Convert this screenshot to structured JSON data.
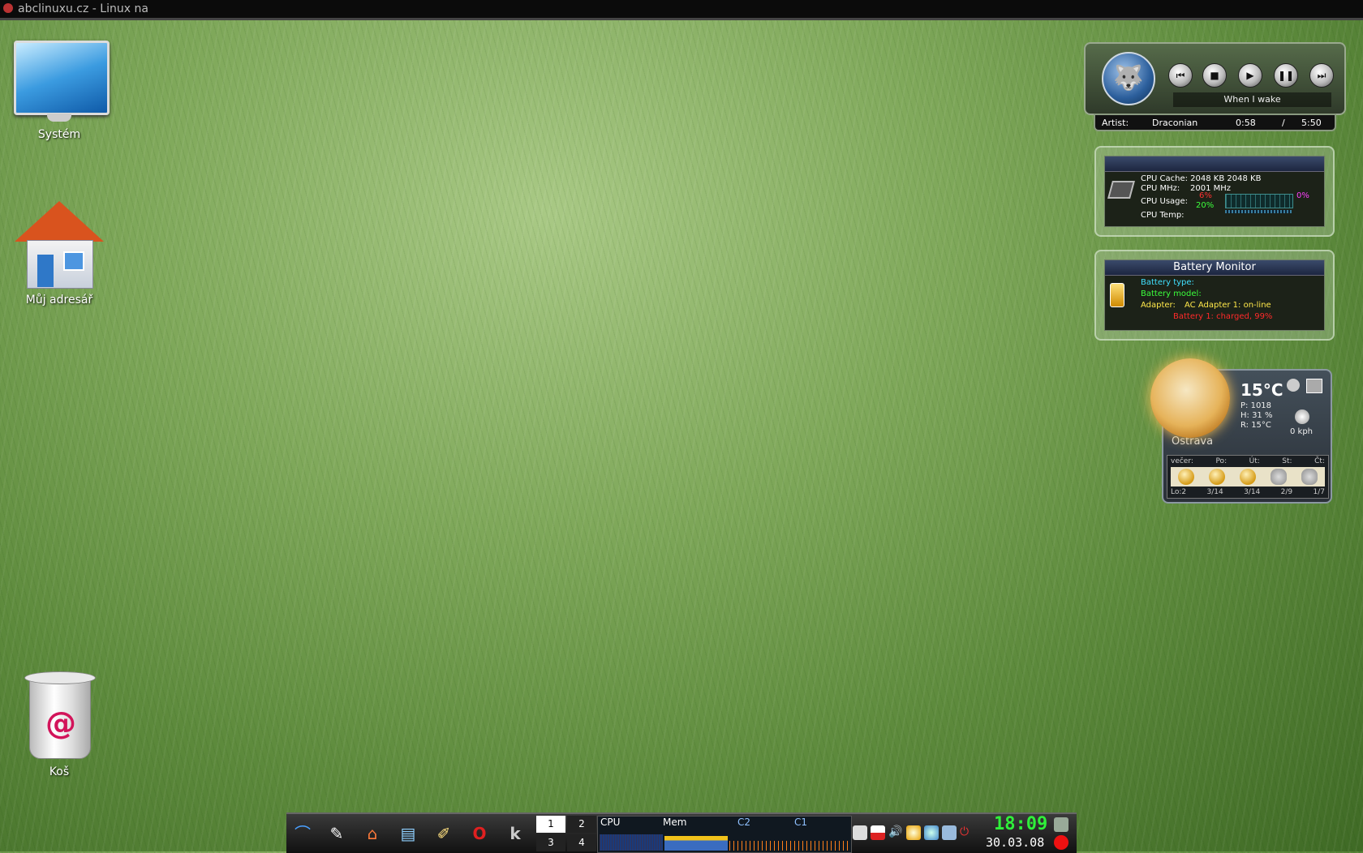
{
  "window": {
    "title": "abclinuxu.cz - Linux na"
  },
  "desktop": {
    "icons": [
      {
        "label": "Systém",
        "icon": "computer-icon"
      },
      {
        "label": "Můj adresář",
        "icon": "home-folder-icon"
      },
      {
        "label": "Koš",
        "icon": "trash-icon"
      }
    ]
  },
  "player": {
    "song": "When I wake",
    "artist_label": "Artist:",
    "artist": "Draconian",
    "elapsed": "0:58",
    "separator": "/",
    "total": "5:50",
    "buttons": [
      "previous",
      "stop",
      "play",
      "pause",
      "next"
    ]
  },
  "cpu": {
    "cache_label": "CPU Cache:",
    "cache_value": "2048 KB 2048 KB",
    "mhz_label": "CPU MHz:",
    "mhz_value": "2001 MHz",
    "usage_label": "CPU Usage:",
    "usage_1": "6%",
    "usage_2": "20%",
    "usage_right_1": "0%",
    "temp_label": "CPU Temp:"
  },
  "battery": {
    "title": "Battery  Monitor",
    "type_label": "Battery type:",
    "model_label": "Battery model:",
    "adapter_label": "Adapter:",
    "adapter_value": "AC Adapter 1: on-line",
    "status": "Battery 1: charged, 99%"
  },
  "weather": {
    "temp": "15°C",
    "pressure": "P: 1018",
    "humidity": "H: 31 %",
    "real": "R: 15°C",
    "wind": "0 kph",
    "city": "Ostrava",
    "forecast_days": [
      "večer:",
      "Po:",
      "Út:",
      "St:",
      "Čt:"
    ],
    "forecast_temps": [
      "Lo:2",
      "3/14",
      "3/14",
      "2/9",
      "1/7"
    ]
  },
  "taskbar": {
    "pager": [
      "1",
      "2",
      "3",
      "4"
    ],
    "sysmon_labels": {
      "cpu": "CPU",
      "mem": "Mem",
      "c2": "C2",
      "c1": "C1"
    },
    "time": "18:09",
    "date": "30.03.08"
  },
  "colors": {
    "clock": "#2ff03a",
    "battery_status": "#ff2a2a",
    "cpu_usage_low": "#ff3030",
    "cpu_usage_mid": "#3cff3c"
  }
}
